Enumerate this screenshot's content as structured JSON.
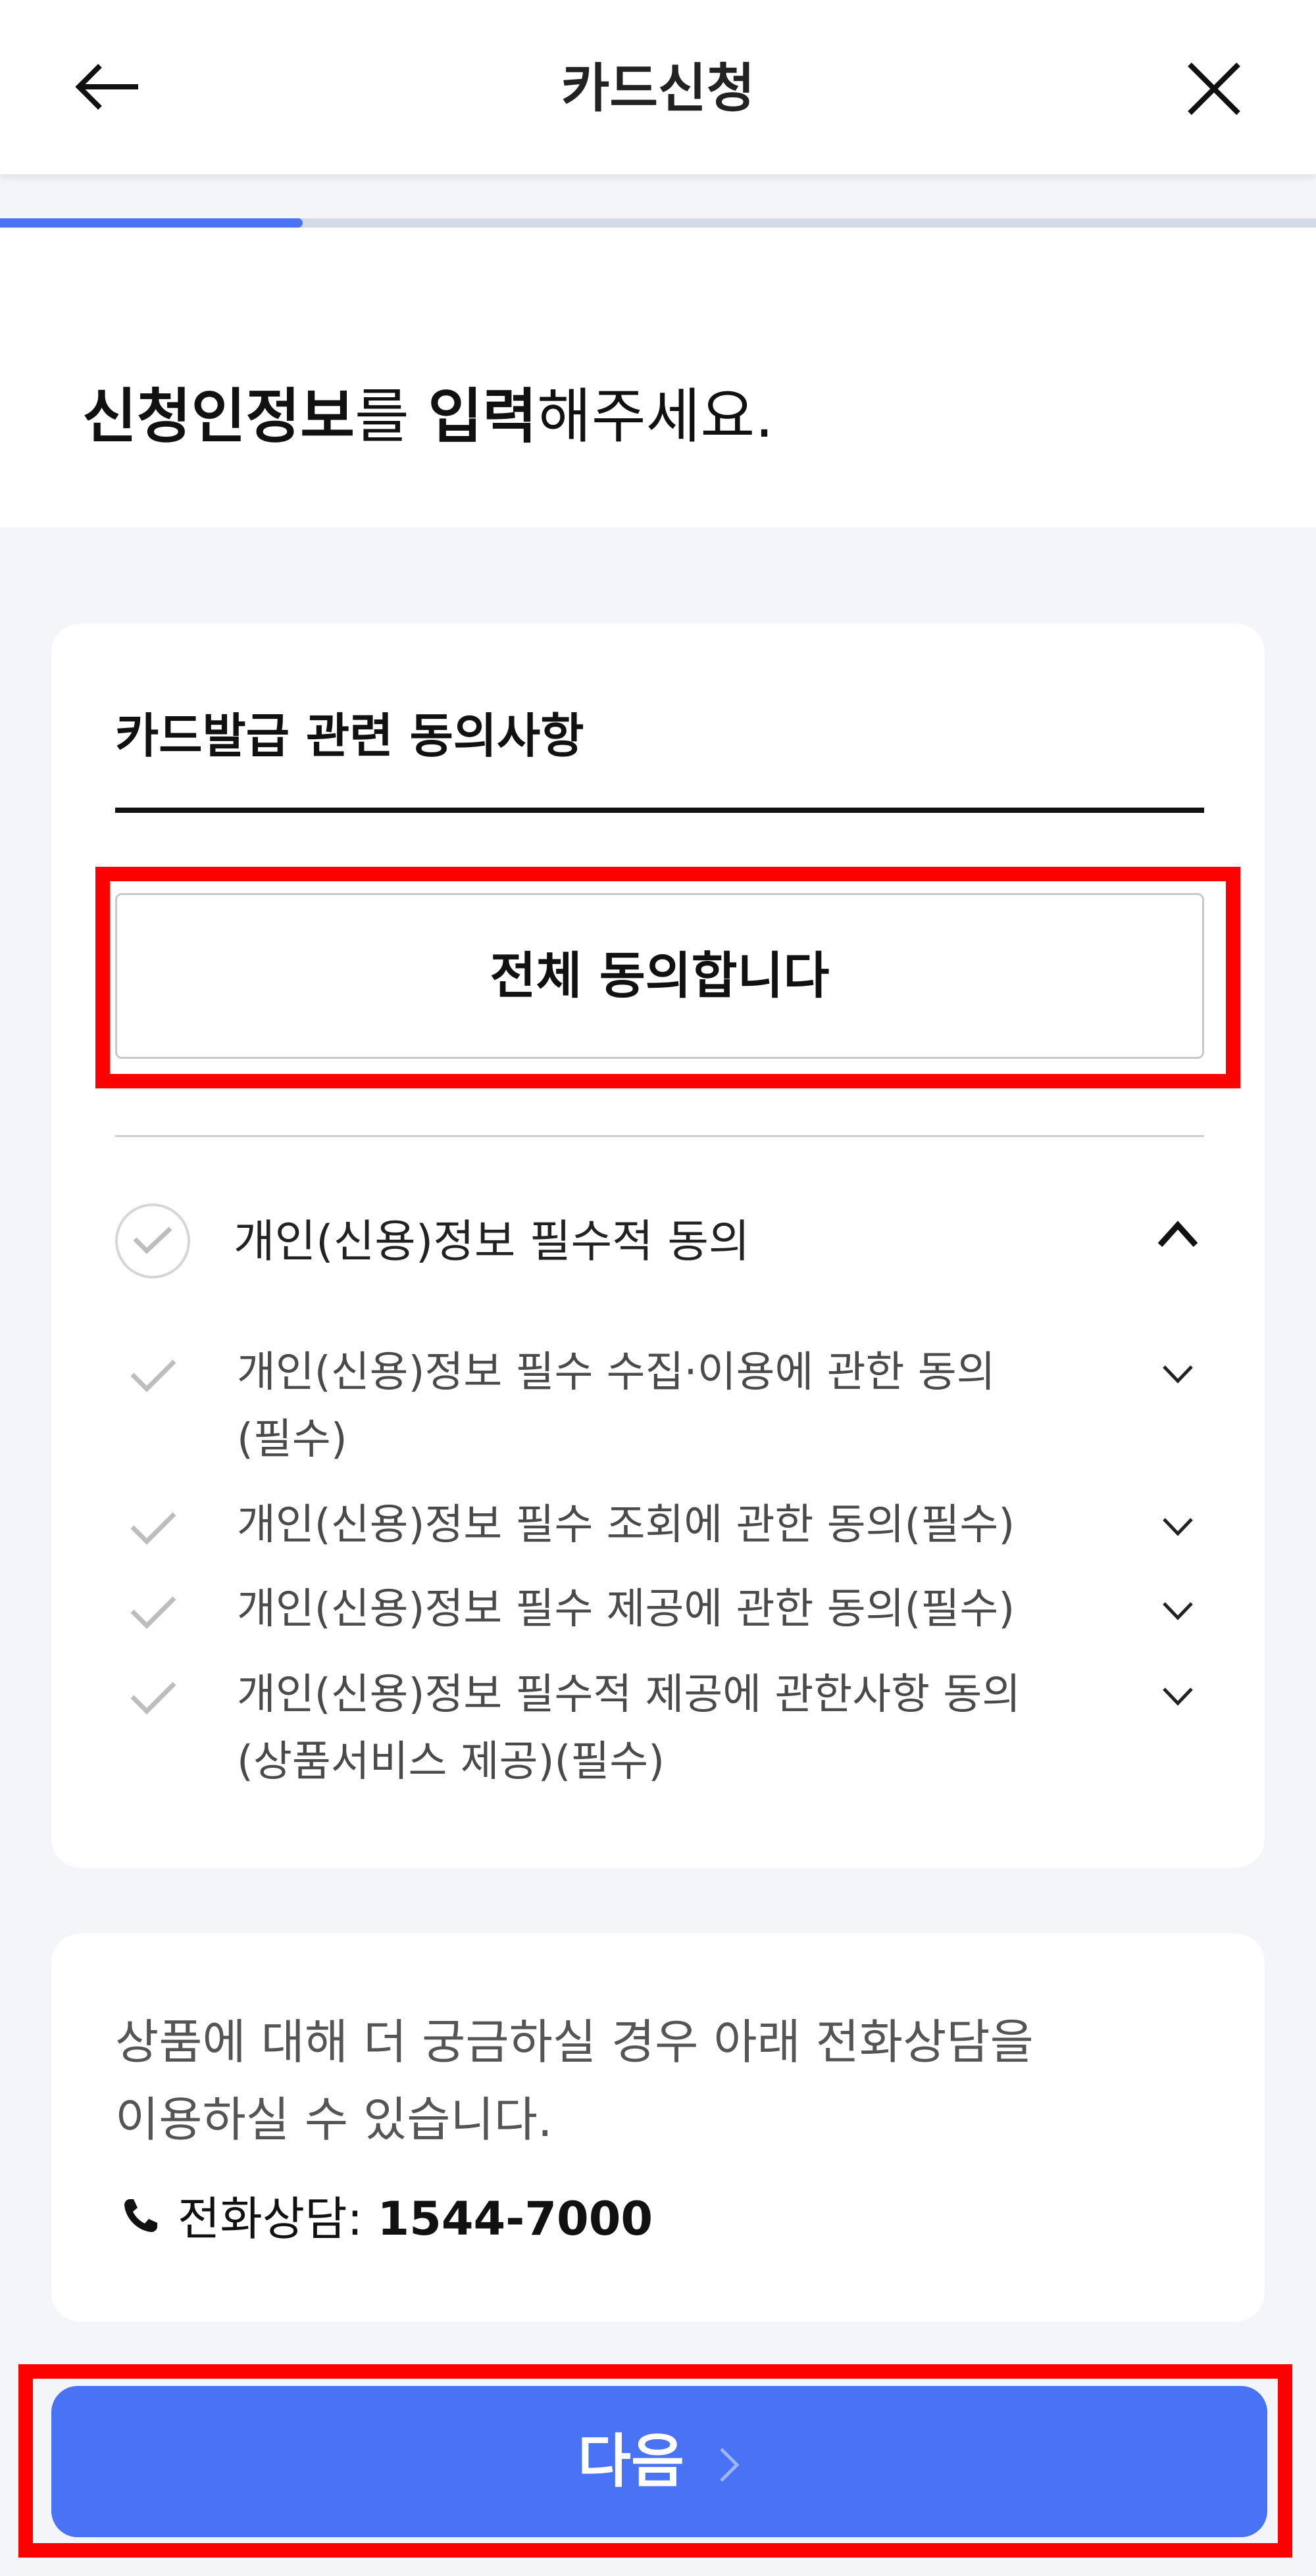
{
  "header": {
    "title": "카드신청"
  },
  "progress": {
    "value": 0.23
  },
  "headline": {
    "bold1": "신청인정보",
    "normal1": "를 ",
    "bold2": "입력",
    "normal2": "해주세요."
  },
  "consent": {
    "section_title": "카드발급 관련 동의사항",
    "agree_all_label": "전체 동의합니다",
    "group_label": "개인(신용)정보 필수적 동의",
    "items": [
      {
        "line1": "개인(신용)정보 필수 수집·이용에 관한 동의",
        "line2": "(필수)"
      },
      {
        "line1": "개인(신용)정보 필수 조회에 관한 동의(필수)",
        "line2": ""
      },
      {
        "line1": "개인(신용)정보 필수 제공에 관한 동의(필수)",
        "line2": ""
      },
      {
        "line1": "개인(신용)정보 필수적 제공에 관한사항 동의",
        "line2": "(상품서비스 제공)(필수)"
      }
    ]
  },
  "info": {
    "line1": "상품에 대해 더 궁금하실 경우 아래 전화상담을",
    "line2": "이용하실 수 있습니다.",
    "phone_label": "전화상담: ",
    "phone_number": "1544-7000"
  },
  "footer": {
    "next_label": "다음"
  },
  "colors": {
    "accent": "#4a72f5",
    "highlight": "#ff0000",
    "background": "#f3f5f9"
  }
}
